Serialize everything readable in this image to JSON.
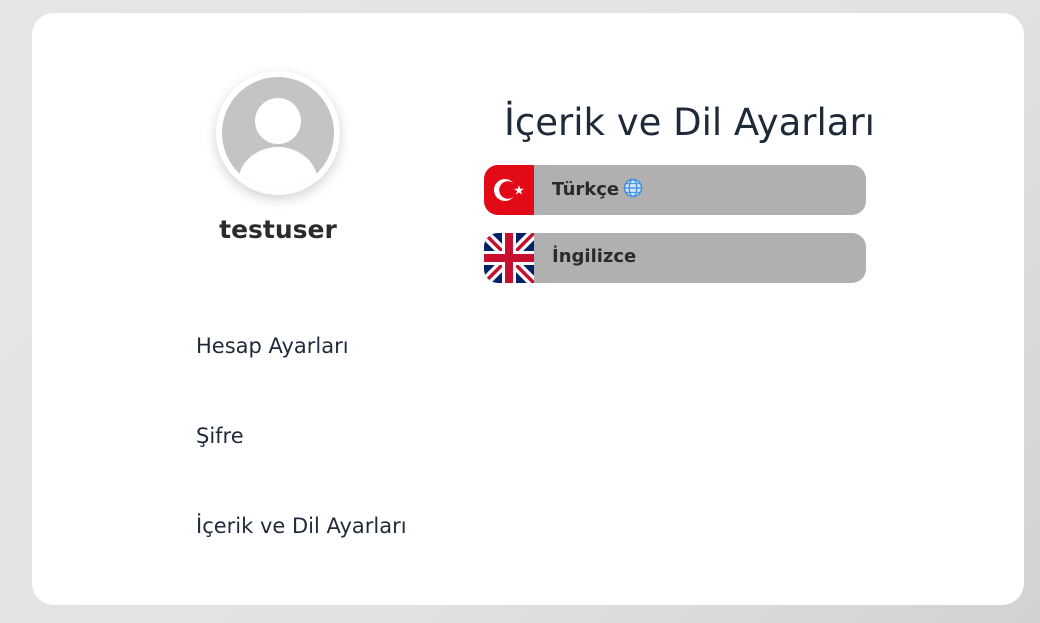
{
  "profile": {
    "username": "testuser",
    "avatar_icon": "user-avatar-icon"
  },
  "menu": {
    "items": [
      {
        "label": "Hesap Ayarları"
      },
      {
        "label": "Şifre"
      },
      {
        "label": "İçerik ve Dil Ayarları"
      }
    ]
  },
  "main": {
    "title": "İçerik ve Dil Ayarları",
    "languages": [
      {
        "label": "Türkçe",
        "flag_icon": "turkey-flag-icon",
        "selected": true,
        "selected_icon": "globe-icon"
      },
      {
        "label": "İngilizce",
        "flag_icon": "uk-flag-icon",
        "selected": false
      }
    ]
  },
  "colors": {
    "card_background": "#ffffff",
    "language_button_background": "#b0b0b0",
    "turkey_flag_red": "#e30a17",
    "globe_blue": "#3b8de0",
    "title_color": "#1e2a3a"
  }
}
